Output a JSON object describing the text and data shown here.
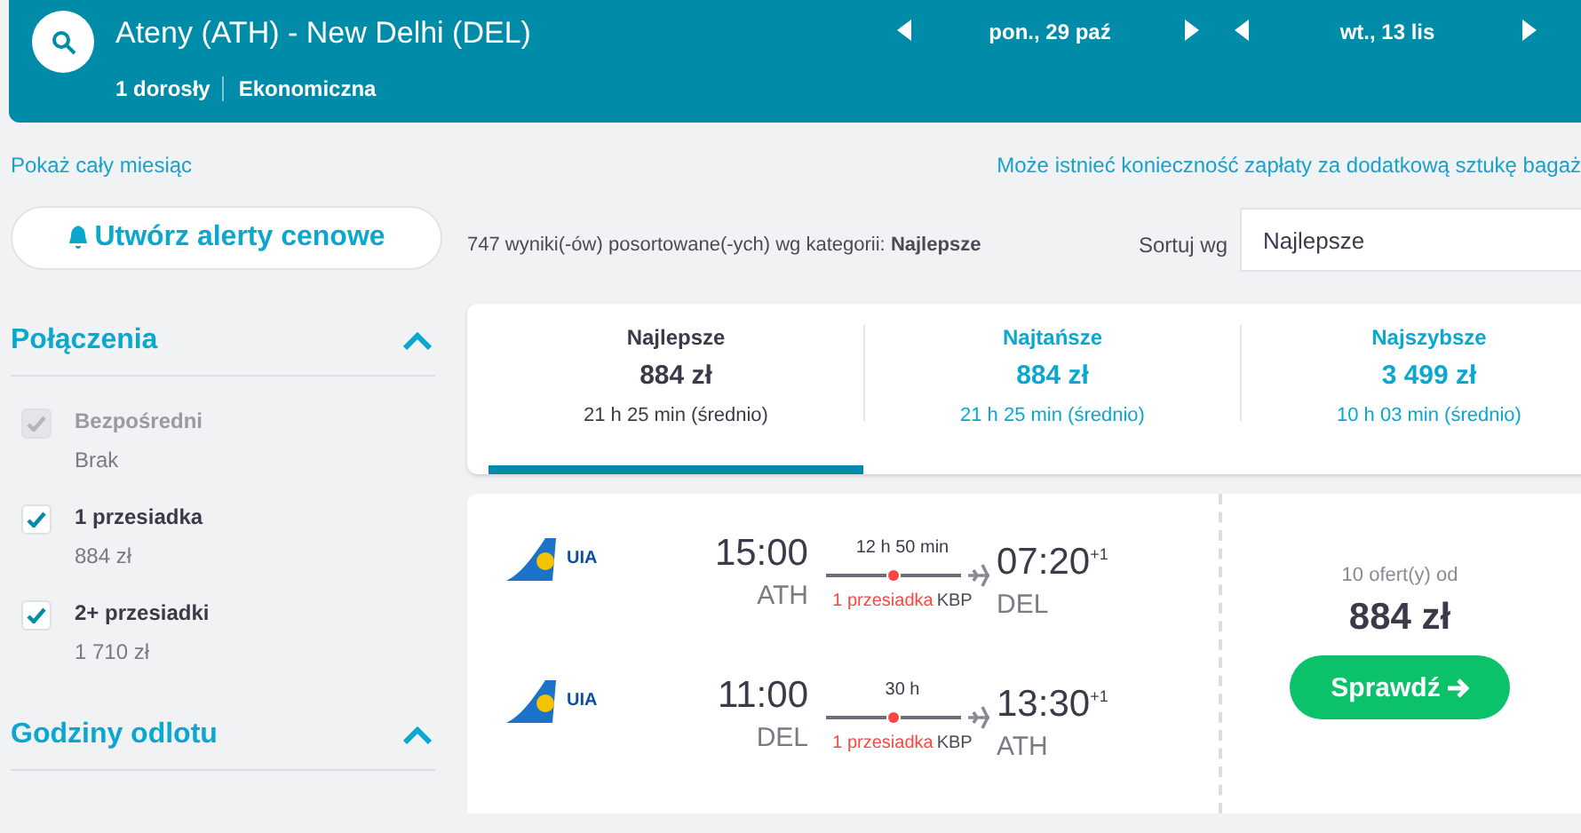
{
  "header": {
    "route": "Ateny (ATH) - New Delhi (DEL)",
    "passengers": "1 dorosły",
    "cabin": "Ekonomiczna",
    "dates": [
      "pon., 29 paź",
      "wt., 13 lis"
    ]
  },
  "links": {
    "month": "Pokaż cały miesiąc",
    "baggage": "Może istnieć konieczność zapłaty za dodatkową sztukę bagaż"
  },
  "alert_button": "Utwórz alerty cenowe",
  "results_summary": "747 wyniki(-ów) posortowane(-ych) wg kategorii: **Najlepsze**",
  "sort": {
    "label": "Sortuj wg",
    "value": "Najlepsze"
  },
  "filters": [
    {
      "title": "Połączenia",
      "expanded": true,
      "options": [
        {
          "label": "Bezpośredni",
          "price": "Brak",
          "checked": true,
          "disabled": true
        },
        {
          "label": "1 przesiadka",
          "price": "884 zł",
          "checked": true,
          "disabled": false
        },
        {
          "label": "2+ przesiadki",
          "price": "1 710 zł",
          "checked": true,
          "disabled": false
        }
      ]
    },
    {
      "title": "Godziny odlotu",
      "expanded": true
    }
  ],
  "sort_tabs": [
    {
      "label": "Najlepsze",
      "price": "884 zł",
      "duration": "21 h 25 min (średnio)",
      "selected": true
    },
    {
      "label": "Najtańsze",
      "price": "884 zł",
      "duration": "21 h 25 min (średnio)",
      "selected": false
    },
    {
      "label": "Najszybsze",
      "price": "3 499 zł",
      "duration": "10 h 03 min (średnio)",
      "selected": false
    }
  ],
  "result": {
    "legs": [
      {
        "airline": "UIA",
        "depart_time": "15:00",
        "depart_airport": "ATH",
        "duration": "12 h 50 min",
        "stops": "1 przesiadka",
        "via": "KBP",
        "arrive_time": "07:20",
        "day_offset": "+1",
        "arrive_airport": "DEL"
      },
      {
        "airline": "UIA",
        "depart_time": "11:00",
        "depart_airport": "DEL",
        "duration": "30 h",
        "stops": "1 przesiadka",
        "via": "KBP",
        "arrive_time": "13:30",
        "day_offset": "+1",
        "arrive_airport": "ATH"
      }
    ],
    "offers": "10 ofert(y) od",
    "price": "884 zł",
    "button": "Sprawdź"
  }
}
